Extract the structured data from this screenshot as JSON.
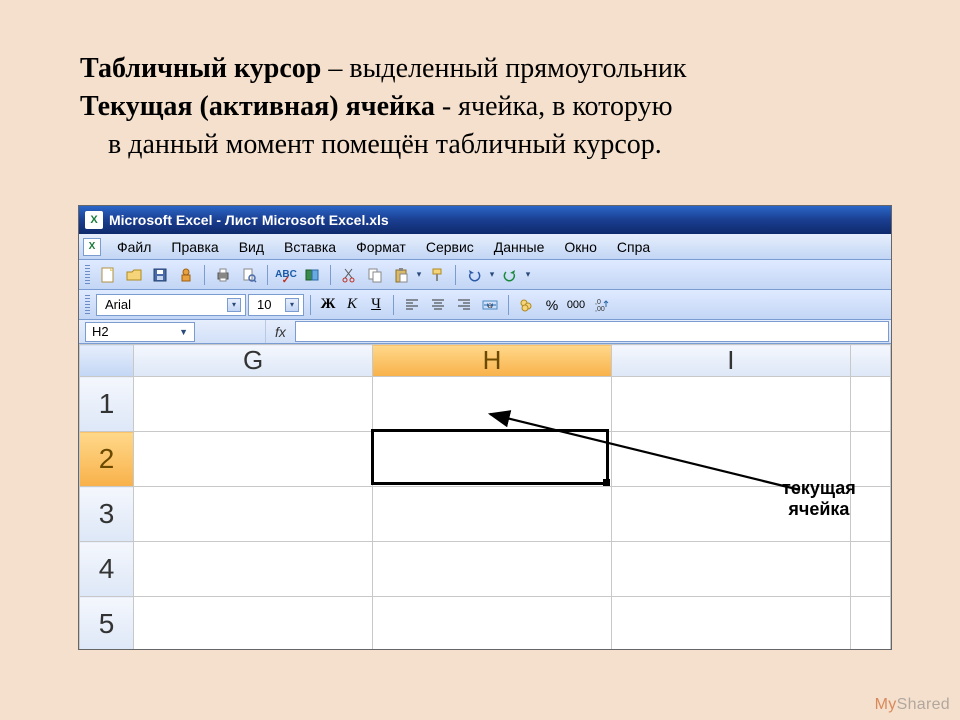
{
  "slide": {
    "term1": "Табличный курсор",
    "def1_rest": " – выделенный прямоугольник",
    "term2": "Текущая (активная) ячейка",
    "def2_rest": "  - ячейка, в которую",
    "def2_line2": "в данный момент помещён табличный курсор."
  },
  "titlebar": {
    "app_icon": "X",
    "title": "Microsoft Excel - Лист Microsoft Excel.xls"
  },
  "menubar": {
    "mini_icon": "X",
    "items": [
      "Файл",
      "Правка",
      "Вид",
      "Вставка",
      "Формат",
      "Сервис",
      "Данные",
      "Окно",
      "Спра"
    ]
  },
  "toolbar1_icons": [
    "new-icon",
    "open-icon",
    "save-icon",
    "permission-icon",
    "print-icon",
    "preview-icon",
    "spellcheck-icon",
    "research-icon",
    "cut-icon",
    "copy-icon",
    "paste-icon",
    "format-painter-icon",
    "undo-icon",
    "redo-icon"
  ],
  "toolbar2": {
    "font_name": "Arial",
    "font_size": "10",
    "bold": "Ж",
    "italic": "К",
    "underline": "Ч",
    "currency_icon": "currency-icon",
    "percent": "%",
    "thousands": "000",
    "decimal_inc": "decimal-inc-icon"
  },
  "formula_row": {
    "name_box": "H2",
    "fx": "fx"
  },
  "grid": {
    "col_headers": [
      "G",
      "H",
      "I"
    ],
    "row_headers": [
      "1",
      "2",
      "3",
      "4",
      "5"
    ],
    "selected_col": "H",
    "selected_row": "2"
  },
  "callout": {
    "line1": "текущая",
    "line2": "ячейка"
  },
  "watermark": {
    "my": "My",
    "shared": "Shared"
  }
}
